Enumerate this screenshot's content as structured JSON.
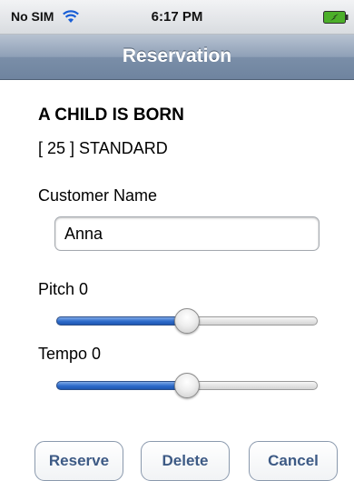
{
  "status_bar": {
    "carrier": "No SIM",
    "time": "6:17 PM"
  },
  "nav": {
    "title": "Reservation"
  },
  "song": {
    "title": "A CHILD IS BORN",
    "id_line": "[ 25 ] STANDARD"
  },
  "form": {
    "customer_label": "Customer Name",
    "customer_value": "Anna",
    "pitch_label": "Pitch  0",
    "pitch_value": 0,
    "pitch_fraction": 0.5,
    "tempo_label": "Tempo  0",
    "tempo_value": 0,
    "tempo_fraction": 0.5
  },
  "buttons": {
    "reserve": "Reserve",
    "delete": "Delete",
    "cancel": "Cancel"
  },
  "colors": {
    "nav_bar": "#8397b2",
    "button_text": "#3d5a85",
    "slider_fill": "#2d6bcb",
    "battery": "#4caf2a"
  },
  "icons": {
    "wifi": "wifi-icon",
    "battery": "battery-charging-icon"
  }
}
